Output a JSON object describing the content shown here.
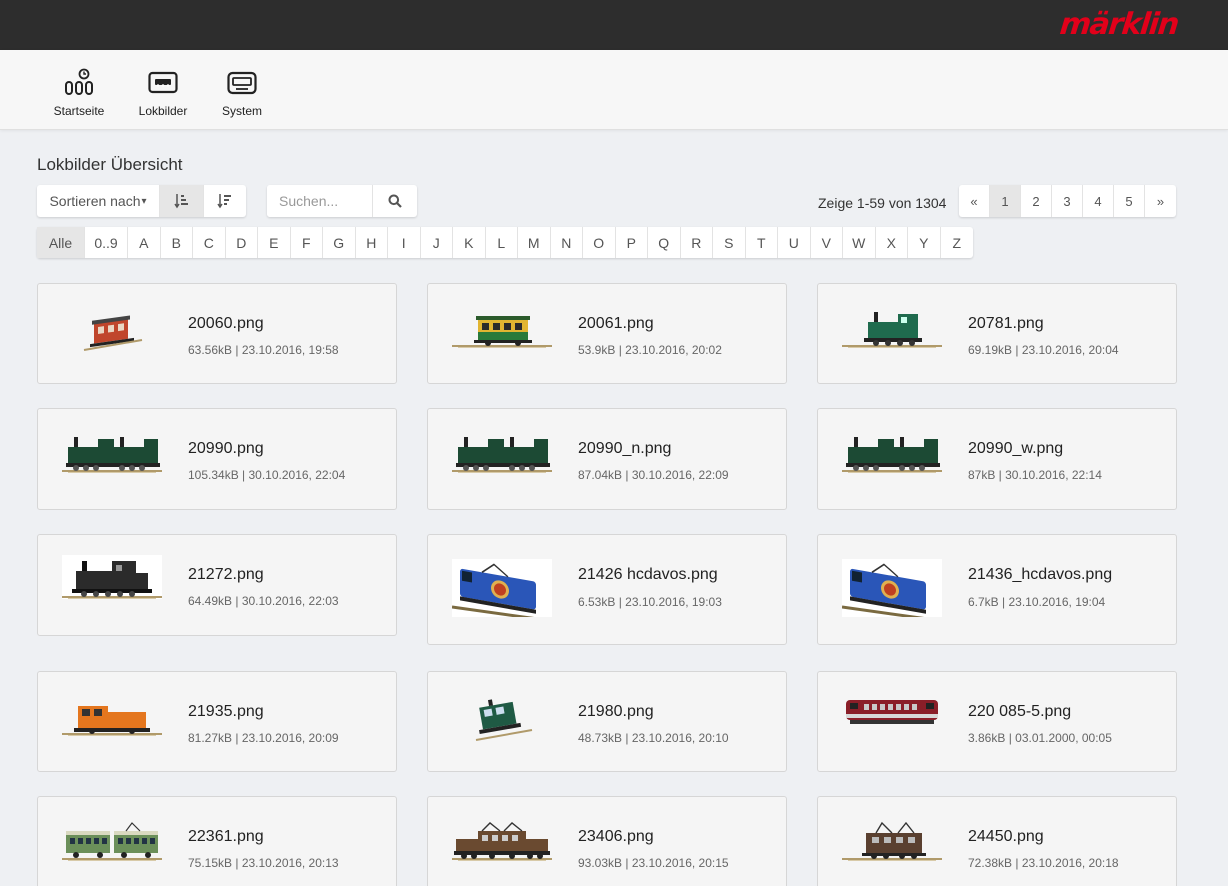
{
  "header": {
    "brand": "märklin"
  },
  "nav": [
    {
      "label": "Startseite",
      "icon": "home-icon"
    },
    {
      "label": "Lokbilder",
      "icon": "locomotive-icon"
    },
    {
      "label": "System",
      "icon": "system-icon"
    }
  ],
  "page": {
    "title": "Lokbilder Übersicht"
  },
  "toolbar": {
    "sort_label": "Sortieren nach",
    "sort_caret": "▾",
    "search_placeholder": "Suchen...",
    "showing": "Zeige 1-59 von 1304"
  },
  "pagination": [
    "«",
    "1",
    "2",
    "3",
    "4",
    "5",
    "»"
  ],
  "pagination_active": "1",
  "alphabet": [
    "Alle",
    "0..9",
    "A",
    "B",
    "C",
    "D",
    "E",
    "F",
    "G",
    "H",
    "I",
    "J",
    "K",
    "L",
    "M",
    "N",
    "O",
    "P",
    "Q",
    "R",
    "S",
    "T",
    "U",
    "V",
    "W",
    "X",
    "Y",
    "Z"
  ],
  "alphabet_active": "Alle",
  "cards": [
    {
      "name": "20060.png",
      "meta": "63.56kB | 23.10.2016, 19:58",
      "thumb": "car-red"
    },
    {
      "name": "20061.png",
      "meta": "53.9kB | 23.10.2016, 20:02",
      "thumb": "car-yellow"
    },
    {
      "name": "20781.png",
      "meta": "69.19kB | 23.10.2016, 20:04",
      "thumb": "steam-green"
    },
    {
      "name": "20990.png",
      "meta": "105.34kB | 30.10.2016, 22:04",
      "thumb": "mallet-green"
    },
    {
      "name": "20990_n.png",
      "meta": "87.04kB | 30.10.2016, 22:09",
      "thumb": "mallet-green"
    },
    {
      "name": "20990_w.png",
      "meta": "87kB | 30.10.2016, 22:14",
      "thumb": "mallet-green"
    },
    {
      "name": "21272.png",
      "meta": "64.49kB | 30.10.2016, 22:03",
      "thumb": "steam-black"
    },
    {
      "name": "21426 hcdavos.png",
      "meta": "6.53kB | 23.10.2016, 19:03",
      "thumb": "electric-blue"
    },
    {
      "name": "21436_hcdavos.png",
      "meta": "6.7kB | 23.10.2016, 19:04",
      "thumb": "electric-blue"
    },
    {
      "name": "21935.png",
      "meta": "81.27kB | 23.10.2016, 20:09",
      "thumb": "diesel-orange"
    },
    {
      "name": "21980.png",
      "meta": "48.73kB | 23.10.2016, 20:10",
      "thumb": "tram-green"
    },
    {
      "name": "220 085-5.png",
      "meta": "3.86kB | 03.01.2000, 00:05",
      "thumb": "diesel-red"
    },
    {
      "name": "22361.png",
      "meta": "75.15kB | 23.10.2016, 20:13",
      "thumb": "railcar-green"
    },
    {
      "name": "23406.png",
      "meta": "93.03kB | 23.10.2016, 20:15",
      "thumb": "crocodile-brown"
    },
    {
      "name": "24450.png",
      "meta": "72.38kB | 23.10.2016, 20:18",
      "thumb": "electric-brown"
    }
  ],
  "colors": {
    "brand": "#e2001a",
    "topbar": "#2d2d2d",
    "navbar": "#f7f7f7",
    "background": "#eef0f3"
  }
}
